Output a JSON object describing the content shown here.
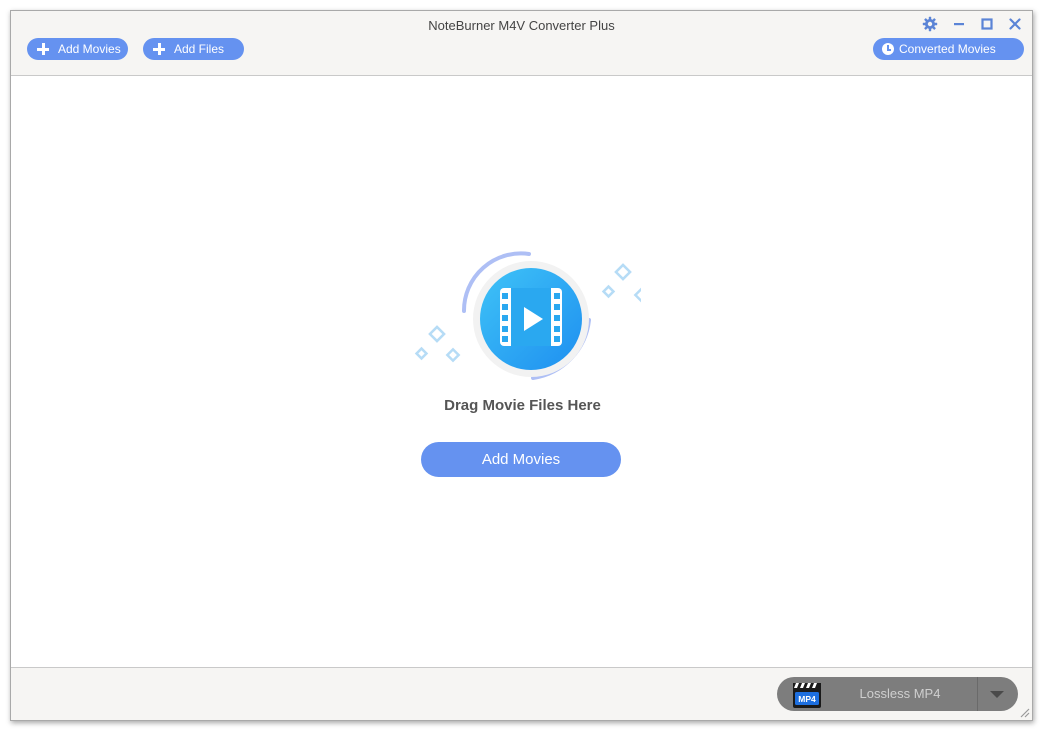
{
  "window": {
    "title": "NoteBurner M4V Converter Plus"
  },
  "toolbar": {
    "add_movies_label": "Add Movies",
    "add_files_label": "Add Files",
    "converted_movies_label": "Converted Movies"
  },
  "controls": {
    "settings_icon": "gear-icon",
    "minimize_icon": "minimize-icon",
    "maximize_icon": "maximize-icon",
    "close_icon": "close-icon"
  },
  "main": {
    "drop_hint": "Drag Movie Files Here",
    "add_movies_button": "Add Movies"
  },
  "footer": {
    "format_label": "Lossless MP4",
    "format_badge": "MP4"
  },
  "colors": {
    "accent": "#6592f0",
    "icon_blue": "#2aa8f0",
    "format_bg": "#7d7d7d"
  }
}
